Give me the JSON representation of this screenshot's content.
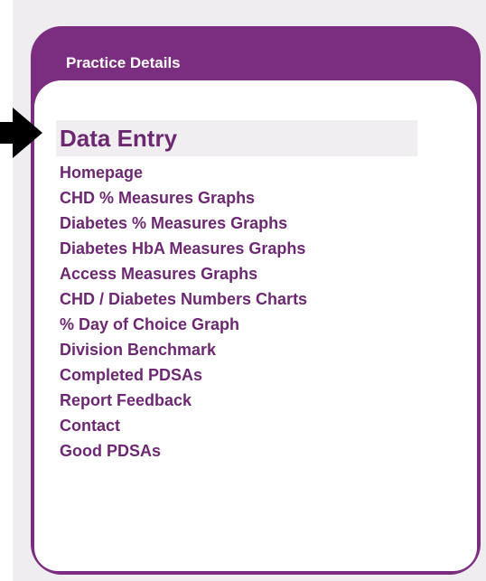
{
  "panel": {
    "title": "Practice Details",
    "active_item": "Data Entry",
    "items": [
      {
        "label": "Homepage"
      },
      {
        "label": "CHD % Measures Graphs"
      },
      {
        "label": "Diabetes % Measures Graphs"
      },
      {
        "label": "Diabetes HbA Measures Graphs"
      },
      {
        "label": "Access Measures Graphs"
      },
      {
        "label": "CHD / Diabetes Numbers Charts"
      },
      {
        "label": "% Day of Choice Graph"
      },
      {
        "label": "Division Benchmark"
      },
      {
        "label": "Completed PDSAs"
      },
      {
        "label": "Report Feedback"
      },
      {
        "label": "Contact"
      },
      {
        "label": "Good PDSAs"
      }
    ]
  },
  "icons": {
    "pointer": "arrow-right-icon"
  },
  "colors": {
    "panel_purple": "#7b2d7f",
    "link_purple": "#6d2872",
    "active_bg": "#f0eef0",
    "page_bg": "#efedef"
  }
}
